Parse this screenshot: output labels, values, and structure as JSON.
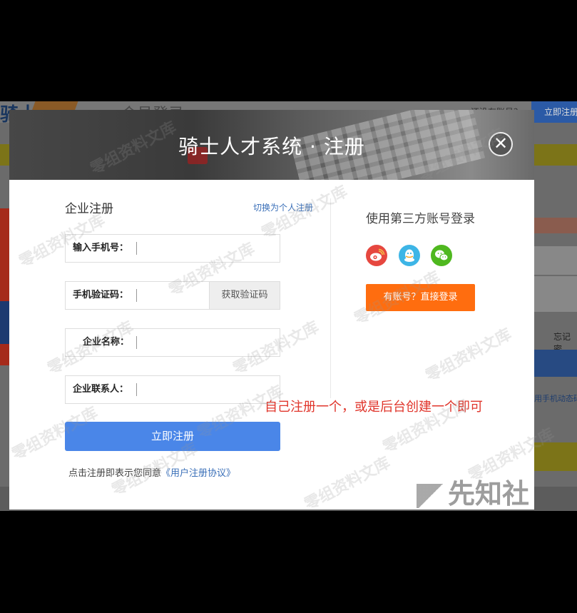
{
  "background_page": {
    "logo": "骑士",
    "title": "会员登录",
    "no_account_text": "还没有账号？",
    "register_now": "立即注册",
    "forgot": "忘记密",
    "phone_login": "用手机动态码"
  },
  "modal": {
    "title": "骑士人才系统 · 注册",
    "close_icon": "✕",
    "form_title": "企业注册",
    "switch_link": "切换为个人注册",
    "fields": {
      "phone_label": "输入手机号：",
      "code_label": "手机验证码：",
      "code_button": "获取验证码",
      "company_label": "企业名称：",
      "contact_label": "企业联系人："
    },
    "submit": "立即注册",
    "agreement_prefix": "点击注册即表示您同意",
    "agreement_link": "《用户注册协议》",
    "third_party_title": "使用第三方账号登录",
    "social": [
      {
        "name": "weibo-icon",
        "color": "#e6473f"
      },
      {
        "name": "qq-icon",
        "color": "#3db5e6"
      },
      {
        "name": "wechat-icon",
        "color": "#4fb81f"
      }
    ],
    "login_button": "有账号？直接登录"
  },
  "annotation": "自己注册一个，或是后台创建一个即可",
  "watermark": "零组资料文库",
  "brand": "先知社"
}
